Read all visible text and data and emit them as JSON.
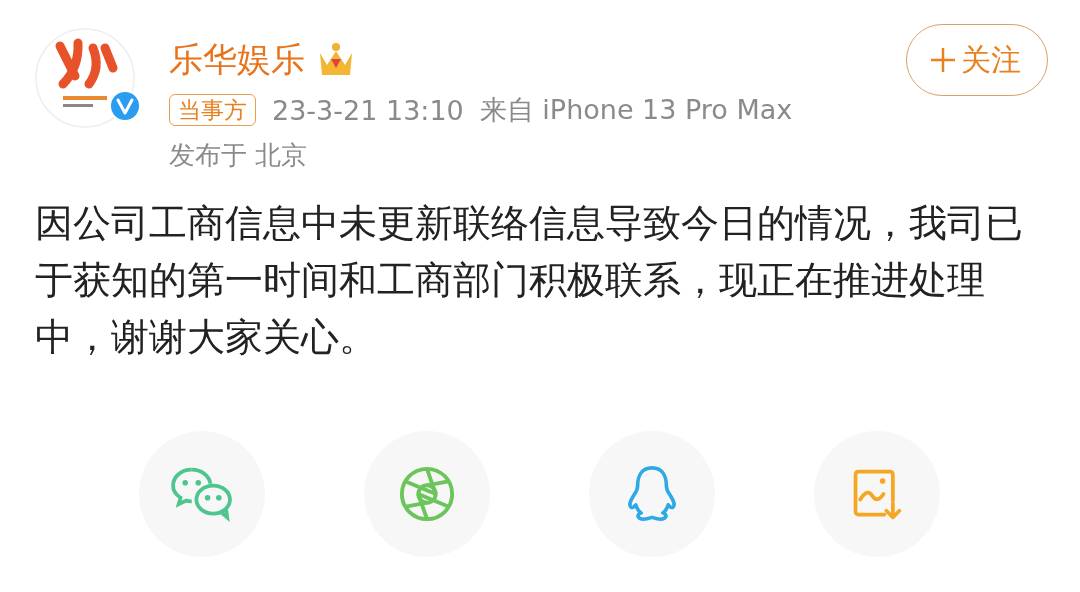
{
  "account": {
    "name": "乐华娱乐",
    "verified": true,
    "tag": "当事方",
    "time": "23-3-21 13:10",
    "source": "来自 iPhone 13 Pro Max",
    "location": "发布于 北京"
  },
  "follow_button": {
    "label": "关注",
    "following": false
  },
  "post": {
    "text": "因公司工商信息中未更新联络信息导致今日的情况，我司已于获知的第一时间和工商部门积极联系，现正在推进处理中，谢谢大家关心。"
  },
  "share_buttons": [
    {
      "kind": "chat"
    },
    {
      "kind": "aperture"
    },
    {
      "kind": "penguin"
    },
    {
      "kind": "save-image"
    }
  ]
}
